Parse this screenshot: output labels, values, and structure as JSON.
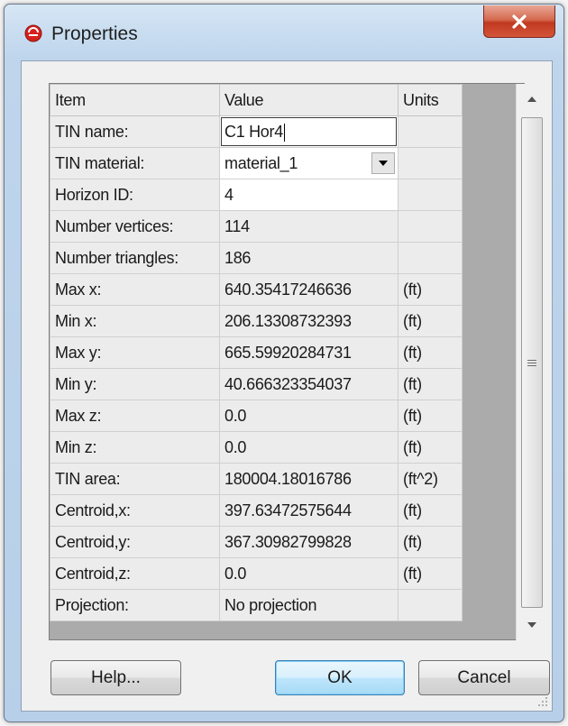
{
  "window": {
    "title": "Properties"
  },
  "grid": {
    "headers": {
      "item": "Item",
      "value": "Value",
      "units": "Units"
    },
    "rows": [
      {
        "item": "TIN name:",
        "value": "C1 Hor4",
        "units": ""
      },
      {
        "item": "TIN material:",
        "value": "material_1",
        "units": ""
      },
      {
        "item": "Horizon ID:",
        "value": "4",
        "units": ""
      },
      {
        "item": "Number vertices:",
        "value": "114",
        "units": ""
      },
      {
        "item": "Number triangles:",
        "value": "186",
        "units": ""
      },
      {
        "item": "Max x:",
        "value": "640.35417246636",
        "units": "(ft)"
      },
      {
        "item": "Min x:",
        "value": "206.13308732393",
        "units": "(ft)"
      },
      {
        "item": "Max y:",
        "value": "665.59920284731",
        "units": "(ft)"
      },
      {
        "item": "Min y:",
        "value": "40.666323354037",
        "units": "(ft)"
      },
      {
        "item": "Max z:",
        "value": "0.0",
        "units": "(ft)"
      },
      {
        "item": "Min z:",
        "value": "0.0",
        "units": "(ft)"
      },
      {
        "item": "TIN area:",
        "value": "180004.18016786",
        "units": "(ft^2)"
      },
      {
        "item": "Centroid,x:",
        "value": "397.63472575644",
        "units": "(ft)"
      },
      {
        "item": "Centroid,y:",
        "value": "367.30982799828",
        "units": "(ft)"
      },
      {
        "item": "Centroid,z:",
        "value": "0.0",
        "units": "(ft)"
      },
      {
        "item": "Projection:",
        "value": "No projection",
        "units": ""
      }
    ]
  },
  "buttons": {
    "help": "Help...",
    "ok": "OK",
    "cancel": "Cancel"
  },
  "icons": {
    "app": "red-circle-logo-icon",
    "close": "close-x-icon",
    "combo": "dropdown-arrow-icon",
    "scroll_up": "scroll-up-arrow-icon",
    "scroll_down": "scroll-down-arrow-icon"
  },
  "colors": {
    "close_button": "#c9472b",
    "ok_border": "#3c7fb1",
    "grid_gutter": "#ababab"
  }
}
